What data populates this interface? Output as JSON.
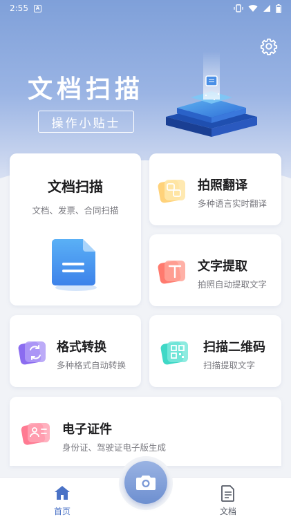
{
  "status": {
    "time": "2:55",
    "notif_letter": "A"
  },
  "header": {
    "title": "文档扫描",
    "tips_label": "操作小贴士"
  },
  "cards": {
    "scan": {
      "title": "文档扫描",
      "sub": "文档、发票、合同扫描"
    },
    "translate": {
      "title": "拍照翻译",
      "sub": "多种语言实时翻译"
    },
    "ocr": {
      "title": "文字提取",
      "sub": "拍照自动提取文字"
    },
    "convert": {
      "title": "格式转换",
      "sub": "多种格式自动转换"
    },
    "qrcode": {
      "title": "扫描二维码",
      "sub": "扫描提取文字"
    },
    "idcard": {
      "title": "电子证件",
      "sub": "身份证、驾驶证电子版生成"
    }
  },
  "nav": {
    "home_label": "首页",
    "docs_label": "文档",
    "active_color": "#4a72c6",
    "inactive_color": "#555a66"
  },
  "icons": {
    "gear": "gear-icon",
    "camera": "camera-icon",
    "home": "home-icon",
    "docs": "document-icon"
  }
}
